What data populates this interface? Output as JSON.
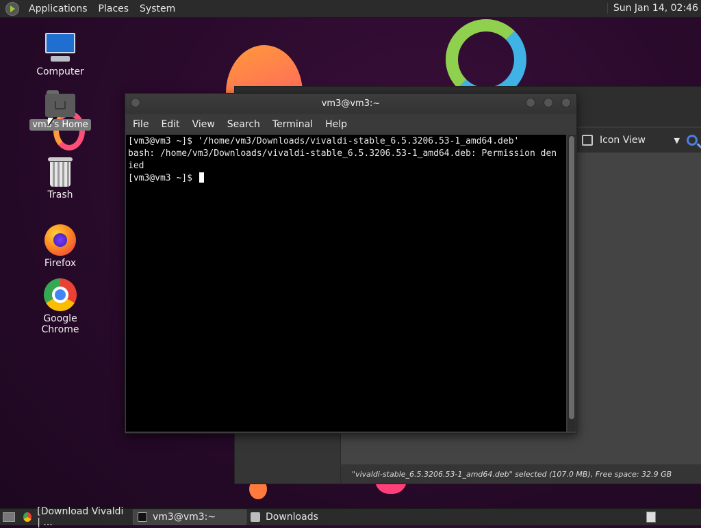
{
  "top_panel": {
    "menus": [
      "Applications",
      "Places",
      "System"
    ],
    "clock": "Sun Jan 14, 02:46"
  },
  "desktop_icons": {
    "computer": "Computer",
    "home": "vm3's Home",
    "trash": "Trash",
    "firefox": "Firefox",
    "chrome": "Google Chrome"
  },
  "file_manager": {
    "view_label": "Icon View",
    "status": "\"vivaldi-stable_6.5.3206.53-1_amd64.deb\" selected (107.0 MB), Free space: 32.9 GB"
  },
  "terminal": {
    "title": "vm3@vm3:~",
    "menu": [
      "File",
      "Edit",
      "View",
      "Search",
      "Terminal",
      "Help"
    ],
    "lines": [
      "[vm3@vm3 ~]$ '/home/vm3/Downloads/vivaldi-stable_6.5.3206.53-1_amd64.deb'",
      "bash: /home/vm3/Downloads/vivaldi-stable_6.5.3206.53-1_amd64.deb: Permission den",
      "ied",
      "[vm3@vm3 ~]$ "
    ]
  },
  "taskbar": {
    "items": [
      "[Download Vivaldi | ...",
      "vm3@vm3:~",
      "Downloads"
    ]
  },
  "colors": {
    "desktop_bg": "#2a0a2c",
    "panel_bg": "#2b2b2b",
    "terminal_bg": "#000000"
  }
}
